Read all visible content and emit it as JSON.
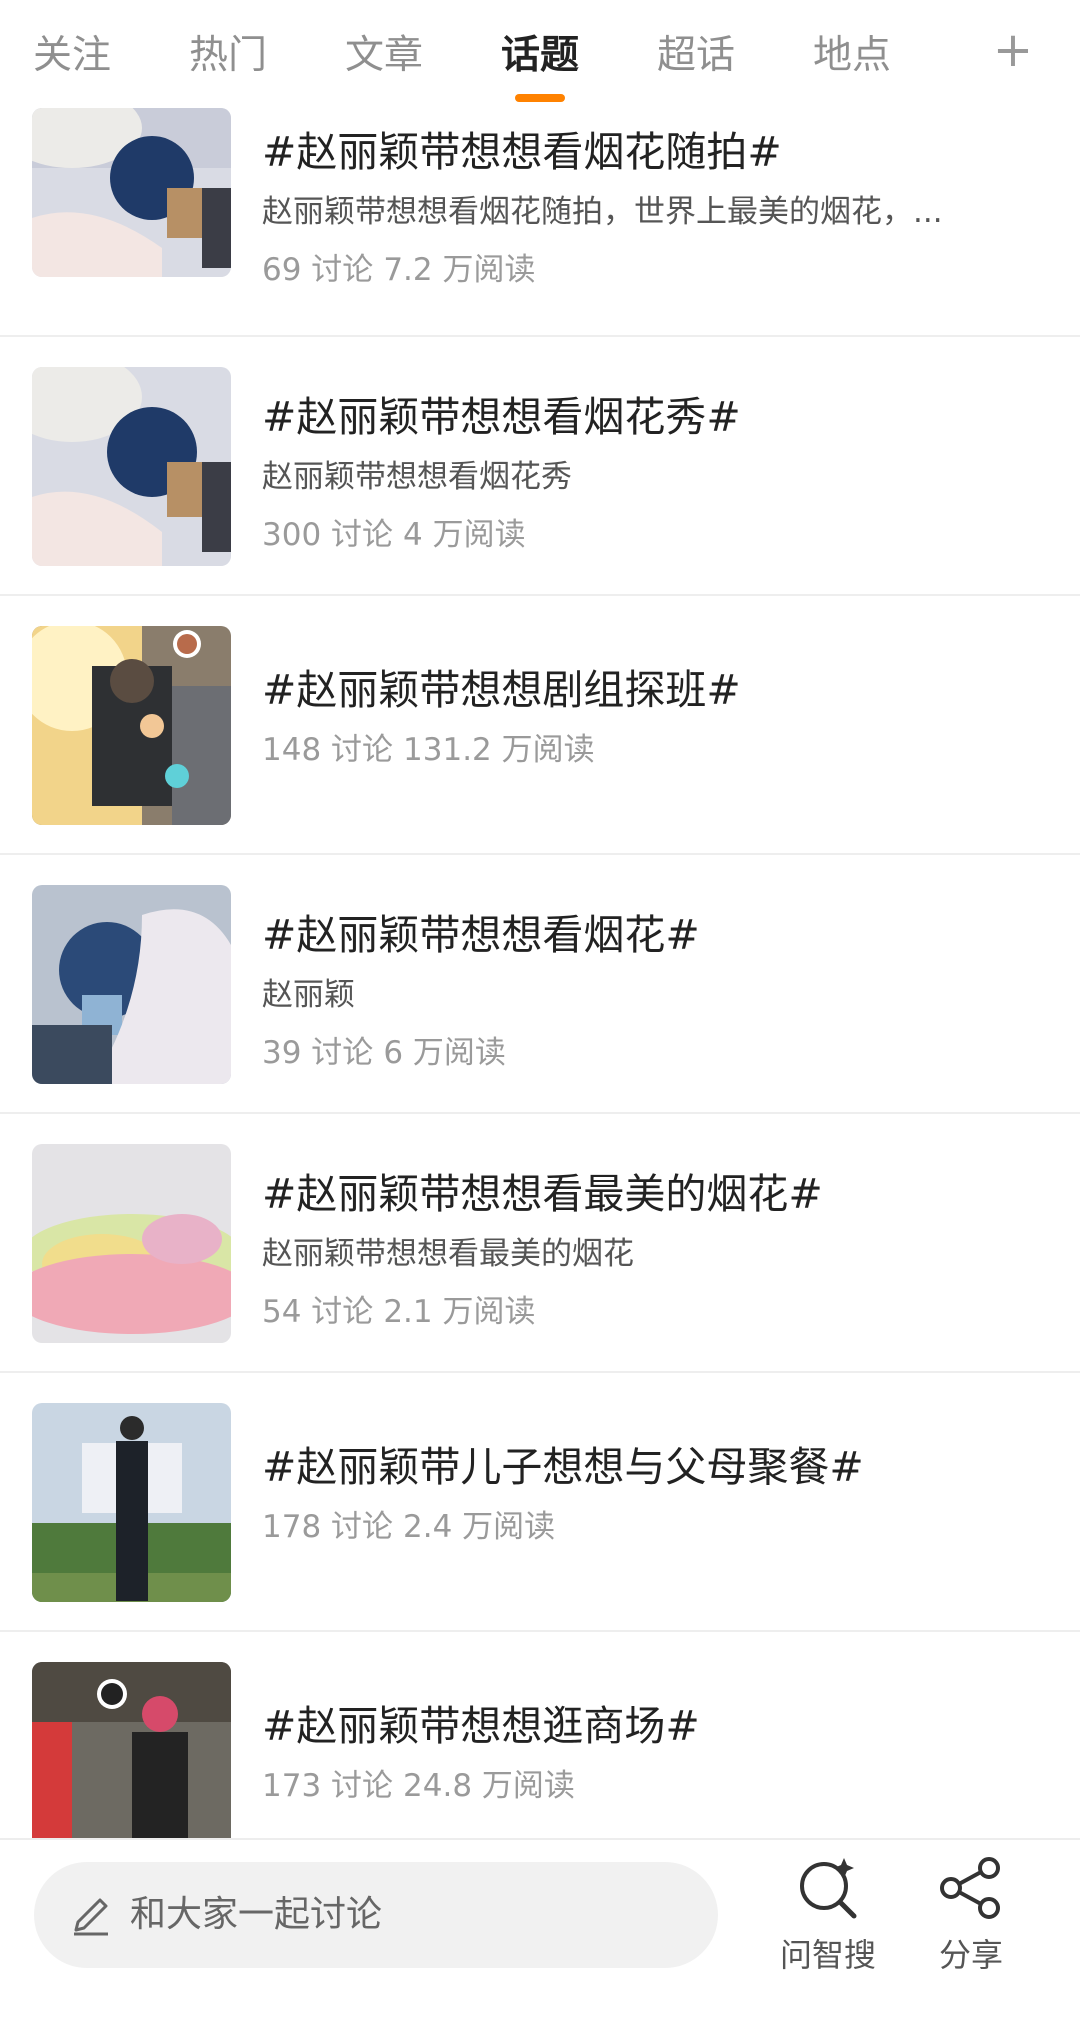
{
  "tabs": [
    {
      "label": "关注",
      "active": false
    },
    {
      "label": "热门",
      "active": false
    },
    {
      "label": "文章",
      "active": false
    },
    {
      "label": "话题",
      "active": true
    },
    {
      "label": "超话",
      "active": false
    },
    {
      "label": "地点",
      "active": false
    }
  ],
  "add_tab_label": "+",
  "accent_color": "#ff8200",
  "topics": [
    {
      "title": "#赵丽颖带想想看烟花随拍#",
      "desc": "赵丽颖带想想看烟花随拍，世界上最美的烟花，...",
      "discussions": "69 讨论",
      "reads": "7.2 万阅读"
    },
    {
      "title": "#赵丽颖带想想看烟花秀#",
      "desc": "赵丽颖带想想看烟花秀",
      "discussions": "300 讨论",
      "reads": "4 万阅读"
    },
    {
      "title": "#赵丽颖带想想剧组探班#",
      "desc": "",
      "discussions": "148 讨论",
      "reads": "131.2 万阅读"
    },
    {
      "title": "#赵丽颖带想想看烟花#",
      "desc": "赵丽颖",
      "discussions": "39 讨论",
      "reads": "6 万阅读"
    },
    {
      "title": "#赵丽颖带想想看最美的烟花#",
      "desc": "赵丽颖带想想看最美的烟花",
      "discussions": "54 讨论",
      "reads": "2.1 万阅读"
    },
    {
      "title": "#赵丽颖带儿子想想与父母聚餐#",
      "desc": "",
      "discussions": "178 讨论",
      "reads": "2.4 万阅读"
    },
    {
      "title": "#赵丽颖带想想逛商场#",
      "desc": "",
      "discussions": "173 讨论",
      "reads": "24.8 万阅读"
    }
  ],
  "bottom": {
    "discuss_placeholder": "和大家一起讨论",
    "ai_search_label": "问智搜",
    "share_label": "分享"
  }
}
